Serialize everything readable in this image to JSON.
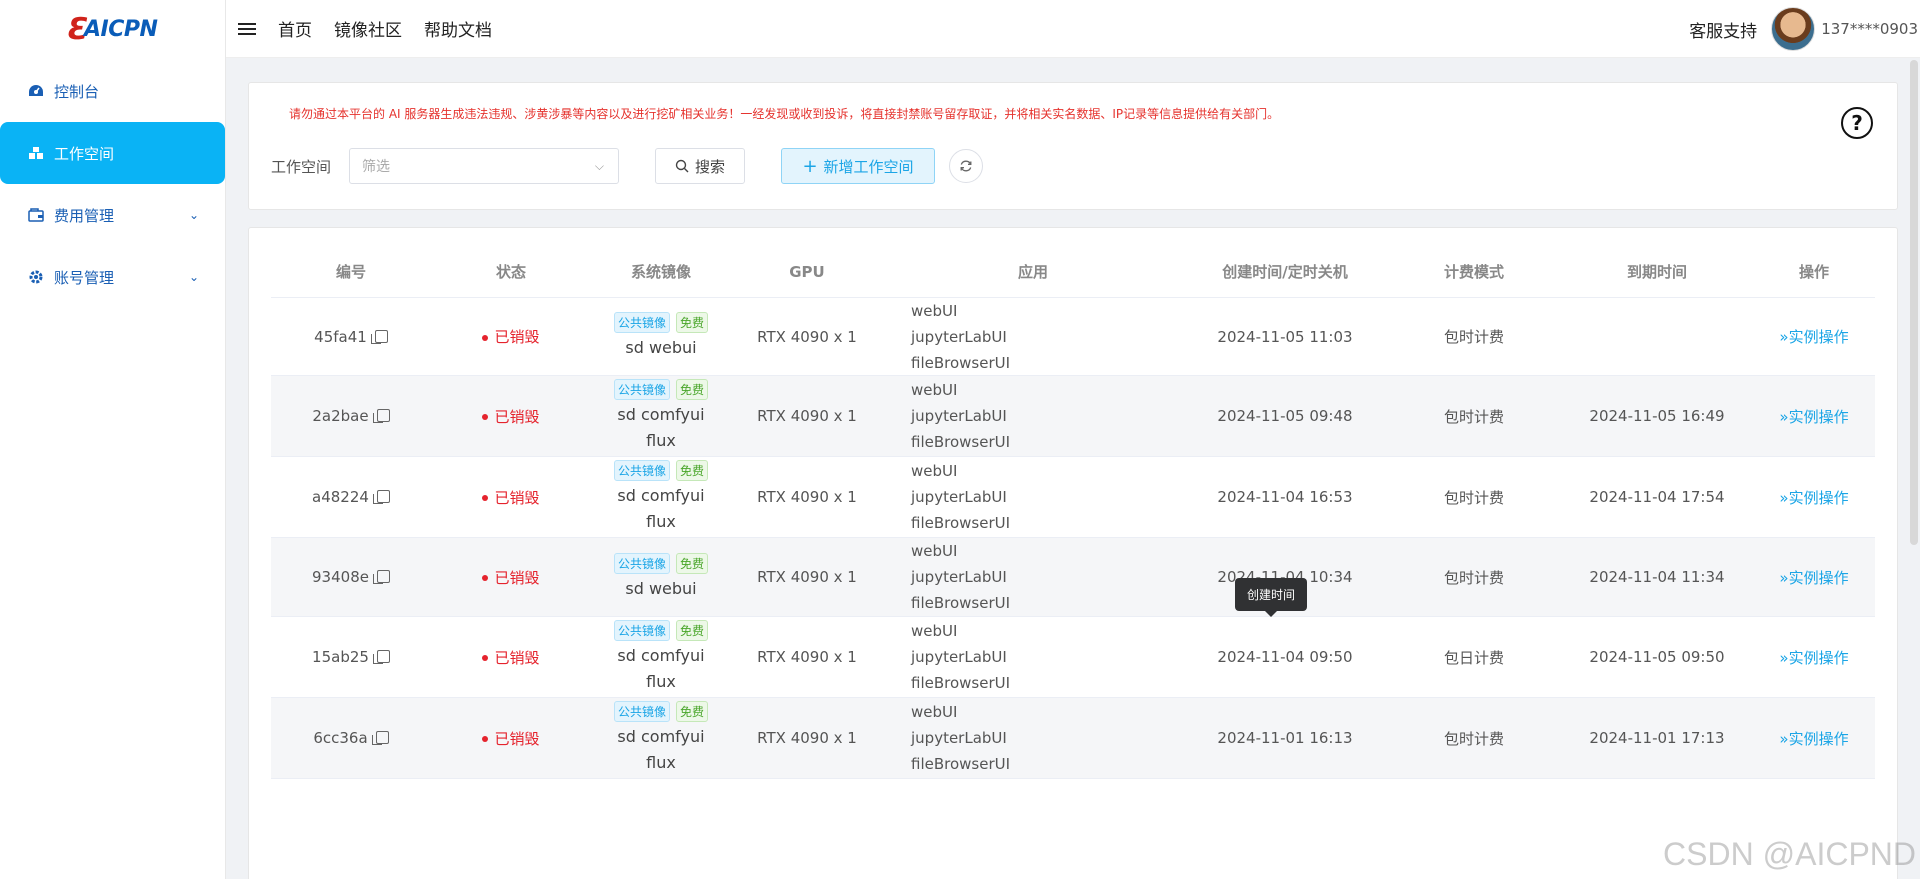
{
  "brand": {
    "logo_text": "AICPN"
  },
  "sidebar": {
    "items": [
      {
        "label": "控制台",
        "icon": "dashboard-icon"
      },
      {
        "label": "工作空间",
        "icon": "workspace-icon",
        "active": true
      },
      {
        "label": "费用管理",
        "icon": "wallet-icon",
        "expandable": true
      },
      {
        "label": "账号管理",
        "icon": "gear-icon",
        "expandable": true
      }
    ]
  },
  "header": {
    "links": [
      "首页",
      "镜像社区",
      "帮助文档"
    ],
    "support": "客服支持",
    "phone": "137****0903"
  },
  "toolbar": {
    "warning": "请勿通过本平台的 AI 服务器生成违法违规、涉黄涉暴等内容以及进行挖矿相关业务！一经发现或收到投诉，将直接封禁账号留存取证，并将相关实名数据、IP记录等信息提供给有关部门。",
    "workspace_label": "工作空间",
    "filter_placeholder": "筛选",
    "search_label": "搜索",
    "add_label": "新增工作空间",
    "help_symbol": "?"
  },
  "table": {
    "headers": [
      "编号",
      "状态",
      "系统镜像",
      "GPU",
      "应用",
      "创建时间/定时关机",
      "计费模式",
      "到期时间",
      "操作"
    ],
    "tag_public": "公共镜像",
    "tag_free": "免费",
    "op_label": "实例操作",
    "rows": [
      {
        "id": "45fa41",
        "status": "已销毁",
        "image": [
          "sd webui"
        ],
        "gpu": "RTX 4090 x 1",
        "apps": [
          "webUI",
          "jupyterLabUI",
          "fileBrowserUI"
        ],
        "created": "2024-11-05 11:03",
        "billing": "包时计费",
        "expires": ""
      },
      {
        "id": "2a2bae",
        "status": "已销毁",
        "image": [
          "sd comfyui",
          "flux"
        ],
        "gpu": "RTX 4090 x 1",
        "apps": [
          "webUI",
          "jupyterLabUI",
          "fileBrowserUI"
        ],
        "created": "2024-11-05 09:48",
        "billing": "包时计费",
        "expires": "2024-11-05 16:49"
      },
      {
        "id": "a48224",
        "status": "已销毁",
        "image": [
          "sd comfyui",
          "flux"
        ],
        "gpu": "RTX 4090 x 1",
        "apps": [
          "webUI",
          "jupyterLabUI",
          "fileBrowserUI"
        ],
        "created": "2024-11-04 16:53",
        "billing": "包时计费",
        "expires": "2024-11-04 17:54"
      },
      {
        "id": "93408e",
        "status": "已销毁",
        "image": [
          "sd webui"
        ],
        "gpu": "RTX 4090 x 1",
        "apps": [
          "webUI",
          "jupyterLabUI",
          "fileBrowserUI"
        ],
        "created": "2024-11-04 10:34",
        "billing": "包时计费",
        "expires": "2024-11-04 11:34"
      },
      {
        "id": "15ab25",
        "status": "已销毁",
        "image": [
          "sd comfyui",
          "flux"
        ],
        "gpu": "RTX 4090 x 1",
        "apps": [
          "webUI",
          "jupyterLabUI",
          "fileBrowserUI"
        ],
        "created": "2024-11-04 09:50",
        "billing": "包日计费",
        "expires": "2024-11-05 09:50"
      },
      {
        "id": "6cc36a",
        "status": "已销毁",
        "image": [
          "sd comfyui",
          "flux"
        ],
        "gpu": "RTX 4090 x 1",
        "apps": [
          "webUI",
          "jupyterLabUI",
          "fileBrowserUI"
        ],
        "created": "2024-11-01 16:13",
        "billing": "包时计费",
        "expires": "2024-11-01 17:13"
      }
    ]
  },
  "tooltip": "创建时间",
  "watermark": "CSDN @AICPND",
  "colors": {
    "accent": "#0ab3f5",
    "danger": "#e5232d",
    "link": "#1ba5e6"
  }
}
